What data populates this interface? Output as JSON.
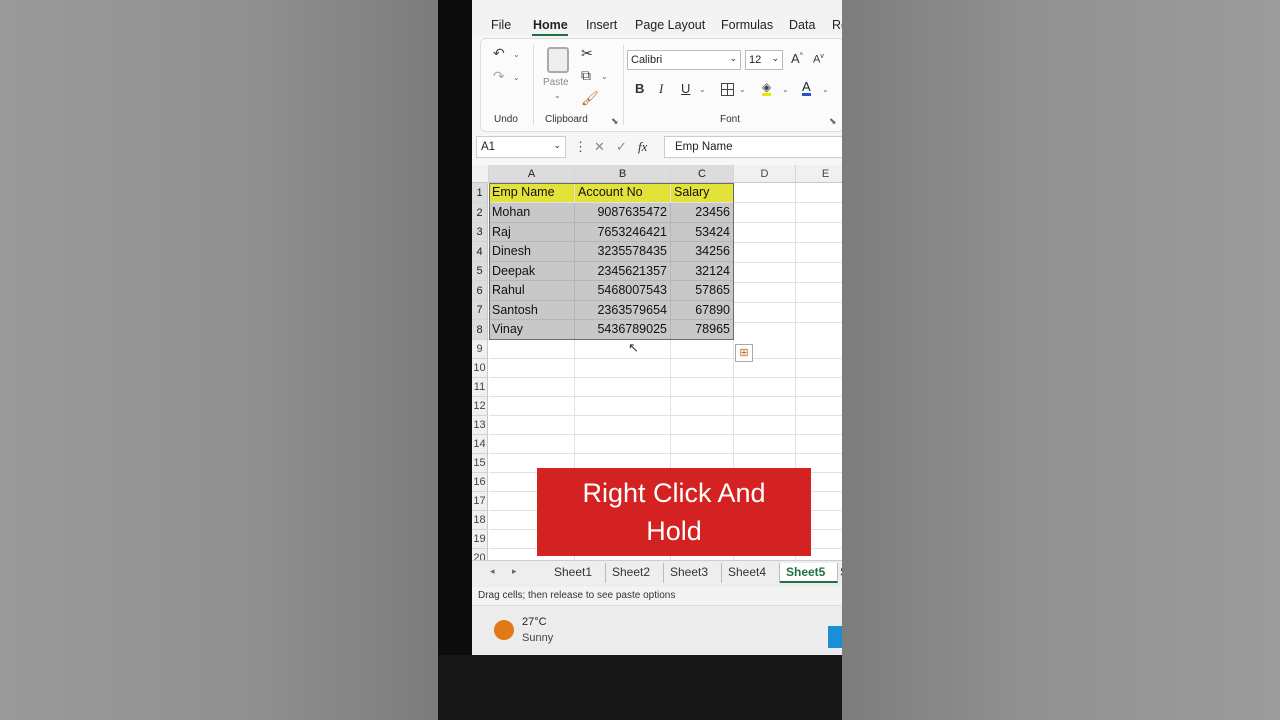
{
  "menu": [
    "File",
    "Home",
    "Insert",
    "Page Layout",
    "Formulas",
    "Data",
    "Re"
  ],
  "ribbon": {
    "undo_label": "Undo",
    "clipboard_label": "Clipboard",
    "paste_label": "Paste",
    "font_label": "Font",
    "font_name": "Calibri",
    "font_size": "12"
  },
  "formula_bar": {
    "name_box": "A1",
    "fx": "fx",
    "value": "Emp Name"
  },
  "columns": [
    "A",
    "B",
    "C",
    "D",
    "E"
  ],
  "rows": [
    "1",
    "2",
    "3",
    "4",
    "5",
    "6",
    "7",
    "8",
    "9",
    "10",
    "11",
    "12",
    "13",
    "14",
    "15",
    "16",
    "17",
    "18",
    "19",
    "20"
  ],
  "table": {
    "headers": [
      "Emp Name",
      "Account No",
      "Salary"
    ],
    "data": [
      [
        "Mohan",
        "9087635472",
        "23456"
      ],
      [
        "Raj",
        "7653246421",
        "53424"
      ],
      [
        "Dinesh",
        "3235578435",
        "34256"
      ],
      [
        "Deepak",
        "2345621357",
        "32124"
      ],
      [
        "Rahul",
        "5468007543",
        "57865"
      ],
      [
        "Santosh",
        "2363579654",
        "67890"
      ],
      [
        "Vinay",
        "5436789025",
        "78965"
      ]
    ]
  },
  "overlay": {
    "line1": "Right Click And",
    "line2": "Hold"
  },
  "sheets": [
    "Sheet1",
    "Sheet2",
    "Sheet3",
    "Sheet4",
    "Sheet5",
    "S"
  ],
  "active_sheet": "Sheet5",
  "status_text": "Drag cells; then release to see paste options",
  "weather": {
    "temp": "27°C",
    "cond": "Sunny"
  },
  "colors": {
    "header_fill": "#e3e23a",
    "selection_fill": "#c8c8c8",
    "banner": "#d42121",
    "excel_green": "#1e7145"
  }
}
